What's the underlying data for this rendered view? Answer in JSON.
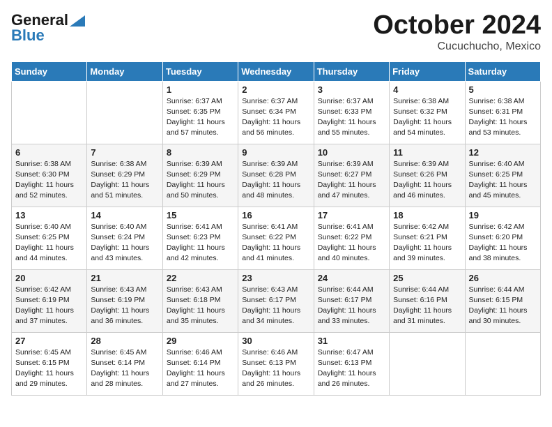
{
  "header": {
    "logo_line1": "General",
    "logo_line2": "Blue",
    "month": "October 2024",
    "location": "Cucuchucho, Mexico"
  },
  "weekdays": [
    "Sunday",
    "Monday",
    "Tuesday",
    "Wednesday",
    "Thursday",
    "Friday",
    "Saturday"
  ],
  "weeks": [
    [
      {
        "day": "",
        "sunrise": "",
        "sunset": "",
        "daylight": ""
      },
      {
        "day": "",
        "sunrise": "",
        "sunset": "",
        "daylight": ""
      },
      {
        "day": "1",
        "sunrise": "Sunrise: 6:37 AM",
        "sunset": "Sunset: 6:35 PM",
        "daylight": "Daylight: 11 hours and 57 minutes."
      },
      {
        "day": "2",
        "sunrise": "Sunrise: 6:37 AM",
        "sunset": "Sunset: 6:34 PM",
        "daylight": "Daylight: 11 hours and 56 minutes."
      },
      {
        "day": "3",
        "sunrise": "Sunrise: 6:37 AM",
        "sunset": "Sunset: 6:33 PM",
        "daylight": "Daylight: 11 hours and 55 minutes."
      },
      {
        "day": "4",
        "sunrise": "Sunrise: 6:38 AM",
        "sunset": "Sunset: 6:32 PM",
        "daylight": "Daylight: 11 hours and 54 minutes."
      },
      {
        "day": "5",
        "sunrise": "Sunrise: 6:38 AM",
        "sunset": "Sunset: 6:31 PM",
        "daylight": "Daylight: 11 hours and 53 minutes."
      }
    ],
    [
      {
        "day": "6",
        "sunrise": "Sunrise: 6:38 AM",
        "sunset": "Sunset: 6:30 PM",
        "daylight": "Daylight: 11 hours and 52 minutes."
      },
      {
        "day": "7",
        "sunrise": "Sunrise: 6:38 AM",
        "sunset": "Sunset: 6:29 PM",
        "daylight": "Daylight: 11 hours and 51 minutes."
      },
      {
        "day": "8",
        "sunrise": "Sunrise: 6:39 AM",
        "sunset": "Sunset: 6:29 PM",
        "daylight": "Daylight: 11 hours and 50 minutes."
      },
      {
        "day": "9",
        "sunrise": "Sunrise: 6:39 AM",
        "sunset": "Sunset: 6:28 PM",
        "daylight": "Daylight: 11 hours and 48 minutes."
      },
      {
        "day": "10",
        "sunrise": "Sunrise: 6:39 AM",
        "sunset": "Sunset: 6:27 PM",
        "daylight": "Daylight: 11 hours and 47 minutes."
      },
      {
        "day": "11",
        "sunrise": "Sunrise: 6:39 AM",
        "sunset": "Sunset: 6:26 PM",
        "daylight": "Daylight: 11 hours and 46 minutes."
      },
      {
        "day": "12",
        "sunrise": "Sunrise: 6:40 AM",
        "sunset": "Sunset: 6:25 PM",
        "daylight": "Daylight: 11 hours and 45 minutes."
      }
    ],
    [
      {
        "day": "13",
        "sunrise": "Sunrise: 6:40 AM",
        "sunset": "Sunset: 6:25 PM",
        "daylight": "Daylight: 11 hours and 44 minutes."
      },
      {
        "day": "14",
        "sunrise": "Sunrise: 6:40 AM",
        "sunset": "Sunset: 6:24 PM",
        "daylight": "Daylight: 11 hours and 43 minutes."
      },
      {
        "day": "15",
        "sunrise": "Sunrise: 6:41 AM",
        "sunset": "Sunset: 6:23 PM",
        "daylight": "Daylight: 11 hours and 42 minutes."
      },
      {
        "day": "16",
        "sunrise": "Sunrise: 6:41 AM",
        "sunset": "Sunset: 6:22 PM",
        "daylight": "Daylight: 11 hours and 41 minutes."
      },
      {
        "day": "17",
        "sunrise": "Sunrise: 6:41 AM",
        "sunset": "Sunset: 6:22 PM",
        "daylight": "Daylight: 11 hours and 40 minutes."
      },
      {
        "day": "18",
        "sunrise": "Sunrise: 6:42 AM",
        "sunset": "Sunset: 6:21 PM",
        "daylight": "Daylight: 11 hours and 39 minutes."
      },
      {
        "day": "19",
        "sunrise": "Sunrise: 6:42 AM",
        "sunset": "Sunset: 6:20 PM",
        "daylight": "Daylight: 11 hours and 38 minutes."
      }
    ],
    [
      {
        "day": "20",
        "sunrise": "Sunrise: 6:42 AM",
        "sunset": "Sunset: 6:19 PM",
        "daylight": "Daylight: 11 hours and 37 minutes."
      },
      {
        "day": "21",
        "sunrise": "Sunrise: 6:43 AM",
        "sunset": "Sunset: 6:19 PM",
        "daylight": "Daylight: 11 hours and 36 minutes."
      },
      {
        "day": "22",
        "sunrise": "Sunrise: 6:43 AM",
        "sunset": "Sunset: 6:18 PM",
        "daylight": "Daylight: 11 hours and 35 minutes."
      },
      {
        "day": "23",
        "sunrise": "Sunrise: 6:43 AM",
        "sunset": "Sunset: 6:17 PM",
        "daylight": "Daylight: 11 hours and 34 minutes."
      },
      {
        "day": "24",
        "sunrise": "Sunrise: 6:44 AM",
        "sunset": "Sunset: 6:17 PM",
        "daylight": "Daylight: 11 hours and 33 minutes."
      },
      {
        "day": "25",
        "sunrise": "Sunrise: 6:44 AM",
        "sunset": "Sunset: 6:16 PM",
        "daylight": "Daylight: 11 hours and 31 minutes."
      },
      {
        "day": "26",
        "sunrise": "Sunrise: 6:44 AM",
        "sunset": "Sunset: 6:15 PM",
        "daylight": "Daylight: 11 hours and 30 minutes."
      }
    ],
    [
      {
        "day": "27",
        "sunrise": "Sunrise: 6:45 AM",
        "sunset": "Sunset: 6:15 PM",
        "daylight": "Daylight: 11 hours and 29 minutes."
      },
      {
        "day": "28",
        "sunrise": "Sunrise: 6:45 AM",
        "sunset": "Sunset: 6:14 PM",
        "daylight": "Daylight: 11 hours and 28 minutes."
      },
      {
        "day": "29",
        "sunrise": "Sunrise: 6:46 AM",
        "sunset": "Sunset: 6:14 PM",
        "daylight": "Daylight: 11 hours and 27 minutes."
      },
      {
        "day": "30",
        "sunrise": "Sunrise: 6:46 AM",
        "sunset": "Sunset: 6:13 PM",
        "daylight": "Daylight: 11 hours and 26 minutes."
      },
      {
        "day": "31",
        "sunrise": "Sunrise: 6:47 AM",
        "sunset": "Sunset: 6:13 PM",
        "daylight": "Daylight: 11 hours and 26 minutes."
      },
      {
        "day": "",
        "sunrise": "",
        "sunset": "",
        "daylight": ""
      },
      {
        "day": "",
        "sunrise": "",
        "sunset": "",
        "daylight": ""
      }
    ]
  ]
}
